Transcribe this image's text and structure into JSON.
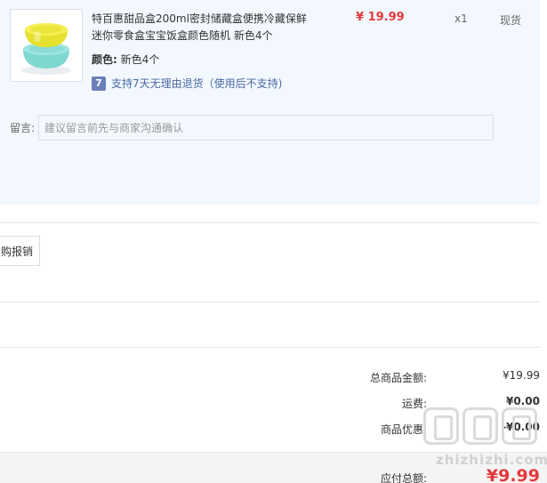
{
  "product": {
    "image_icon": "tupperware-bowls-image",
    "title_line1": "特百惠甜品盒200ml密封储藏盒便携冷藏保鲜",
    "title_line2": "迷你零食盒宝宝饭盒颜色随机 新色4个",
    "price": "¥ 19.99",
    "quantity": "x1",
    "stock_status": "现货",
    "color_label": "颜色:",
    "color_value": "新色4个",
    "return_badge": "7",
    "return_policy": "支持7天无理由退货（使用后不支持)"
  },
  "message": {
    "label": "留言:",
    "placeholder": "建议留言前先与商家沟通确认"
  },
  "invoice": {
    "button_label": "购报销"
  },
  "summary": {
    "goods_total_label": "总商品金额:",
    "goods_total_value": "¥19.99",
    "shipping_label": "运费:",
    "shipping_value": "¥0.00",
    "discount_label": "商品优惠:",
    "discount_value": "-¥0.00",
    "payable_label": "应付总额:",
    "payable_value": "¥9.99"
  },
  "watermark": {
    "text": "zhizhizhi.com"
  },
  "colors": {
    "price_red": "#e4393c",
    "panel_bg": "#f2f8fd",
    "return_badge": "#6b7fb8",
    "link_blue": "#4a67a6"
  }
}
